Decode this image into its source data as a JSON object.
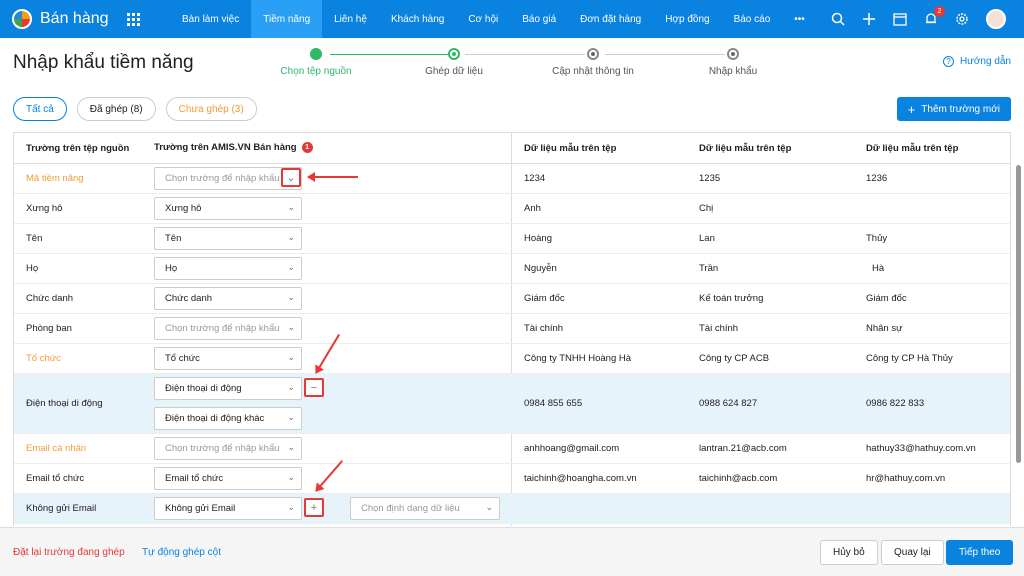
{
  "app": {
    "name": "Bán hàng"
  },
  "nav": [
    "Bàn làm việc",
    "Tiềm năng",
    "Liên hệ",
    "Khách hàng",
    "Cơ hội",
    "Báo giá",
    "Đơn đặt hàng",
    "Hợp đồng",
    "Báo cáo",
    "•••"
  ],
  "notifications": {
    "count": "2"
  },
  "page": {
    "title": "Nhập khẩu tiềm năng",
    "help": "Hướng dẫn"
  },
  "steps": [
    "Chọn tệp nguồn",
    "Ghép dữ liệu",
    "Cập nhật thông tin",
    "Nhập khẩu"
  ],
  "filters": {
    "all": "Tất cả",
    "matched": "Đã ghép (8)",
    "unmatched": "Chưa ghép (3)"
  },
  "add_field": "Thêm trường mới",
  "headers": {
    "source": "Trường trên tệp nguồn",
    "target": "Trường trên AMIS.VN Bán hàng",
    "badge": "1",
    "sample1": "Dữ liệu mẫu trên tệp",
    "sample2": "Dữ liệu mẫu trên tệp",
    "sample3": "Dữ liệu mẫu trên tệp"
  },
  "placeholder": "Chọn trường để nhập khẩu",
  "format_placeholder": "Chọn định dạng dữ liệu",
  "rows": [
    {
      "source": "Mã tiềm năng",
      "target": "",
      "s1": "1234",
      "s2": "1235",
      "s3": "1236"
    },
    {
      "source": "Xưng hô",
      "target": "Xưng hô",
      "s1": "Anh",
      "s2": "Chị",
      "s3": ""
    },
    {
      "source": "Tên",
      "target": "Tên",
      "s1": "Hoàng",
      "s2": "Lan",
      "s3": "Thủy"
    },
    {
      "source": "Họ",
      "target": "Họ",
      "s1": "Nguyễn",
      "s2": "Trần",
      "s3": "Hà"
    },
    {
      "source": "Chức danh",
      "target": "Chức danh",
      "s1": "Giám đốc",
      "s2": "Kế toán trưởng",
      "s3": "Giám đốc"
    },
    {
      "source": "Phòng ban",
      "target": "",
      "s1": "Tài chính",
      "s2": "Tài chính",
      "s3": "Nhân sự"
    },
    {
      "source": "Tổ chức",
      "target": "Tổ chức",
      "s1": "Công ty TNHH Hoàng Hà",
      "s2": "Công ty CP ACB",
      "s3": "Công ty CP Hà Thủy"
    },
    {
      "source": "Điện thoại di động",
      "target": "Điện thoại di động",
      "target2": "Điện thoại di động khác",
      "s1": "0984 855 655",
      "s2": "0988 624 827",
      "s3": "0986 822 833"
    },
    {
      "source": "Email cá nhân",
      "target": "",
      "s1": "anhhoang@gmail.com",
      "s2": "lantran.21@acb.com",
      "s3": "hathuy33@hathuy.com.vn"
    },
    {
      "source": "Email tổ chức",
      "target": "Email tổ chức",
      "s1": "taichinh@hoangha.com.vn",
      "s2": "taichinh@acb.com",
      "s3": "hr@hathuy.com.vn"
    },
    {
      "source": "Không gửi Email",
      "target": "Không gửi Email",
      "s1": "",
      "s2": "",
      "s3": ""
    }
  ],
  "footer": {
    "reset": "Đặt lại trường đang ghép",
    "auto": "Tự động ghép cột",
    "cancel": "Hủy bỏ",
    "back": "Quay lại",
    "next": "Tiếp theo"
  },
  "colors": {
    "primary": "#0a82e0",
    "orange": "#f39c36",
    "red": "#e53935",
    "green": "#2eb868"
  }
}
